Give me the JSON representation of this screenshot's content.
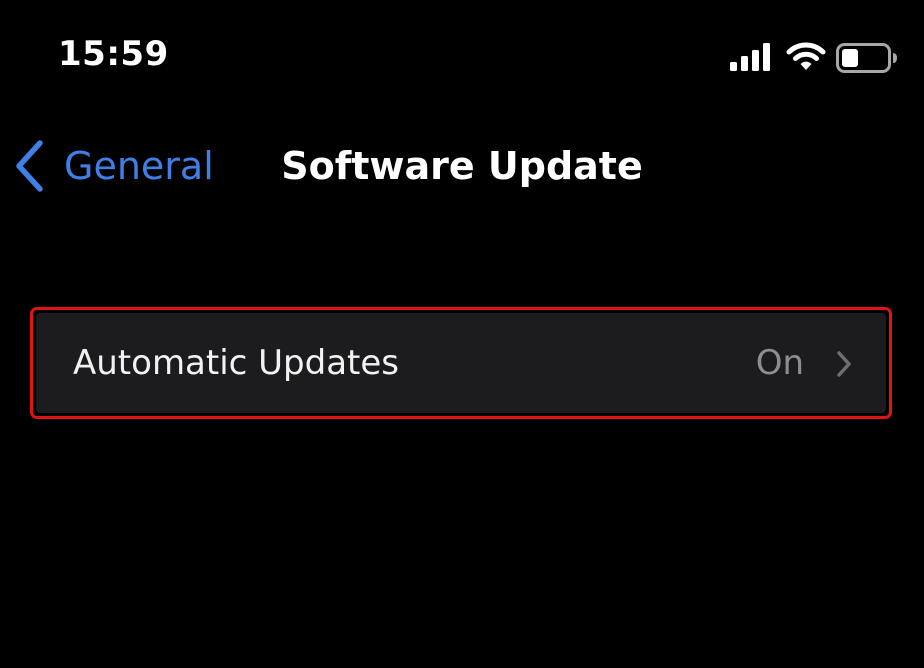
{
  "status_bar": {
    "time": "15:59",
    "icons": [
      "cellular-signal-icon",
      "wifi-icon",
      "battery-icon"
    ]
  },
  "nav": {
    "back_label": "General",
    "title": "Software Update"
  },
  "settings": {
    "rows": [
      {
        "label": "Automatic Updates",
        "value": "On",
        "highlighted": true
      }
    ]
  },
  "colors": {
    "background": "#000000",
    "accent": "#3f7fe6",
    "row_background": "#1c1c1e",
    "highlight_border": "#e01414",
    "secondary_text": "#8d8d92"
  }
}
